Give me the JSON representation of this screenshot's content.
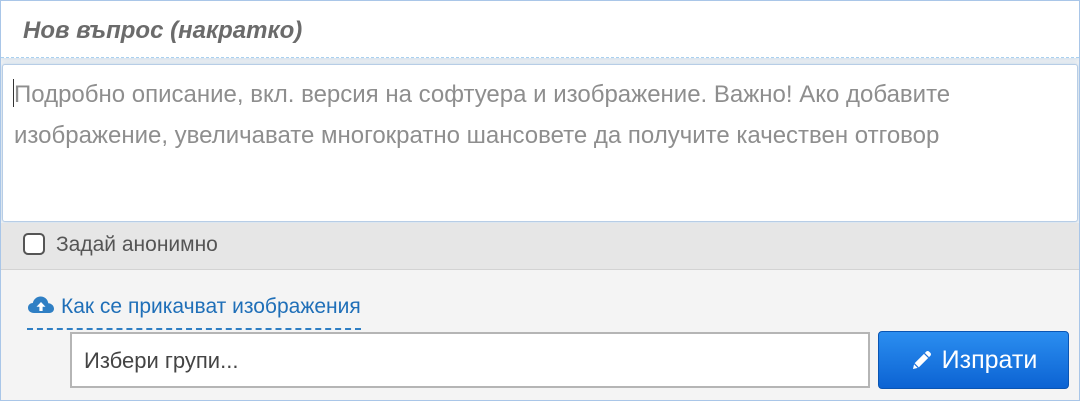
{
  "form": {
    "title_placeholder": "Нов въпрос (накратко)",
    "description_placeholder": "Подробно описание, вкл. версия на софтуера и изображение. Важно! Ако добавите изображение, увеличавате многократно шансовете да получите качествен отговор",
    "anonymous_label": "Задай анонимно",
    "anonymous_checked": false,
    "help_link": {
      "text": "Как се прикачват изображения",
      "icon": "cloud-upload-icon"
    },
    "groups_placeholder": "Избери групи...",
    "send_button": {
      "label": "Изпрати",
      "icon": "pencil-icon"
    }
  },
  "colors": {
    "accent": "#1f6fb8",
    "button_top": "#2b8ef0",
    "button_bottom": "#0c63d3",
    "placeholder": "#8e8e8e",
    "border": "#a9c6e8"
  }
}
